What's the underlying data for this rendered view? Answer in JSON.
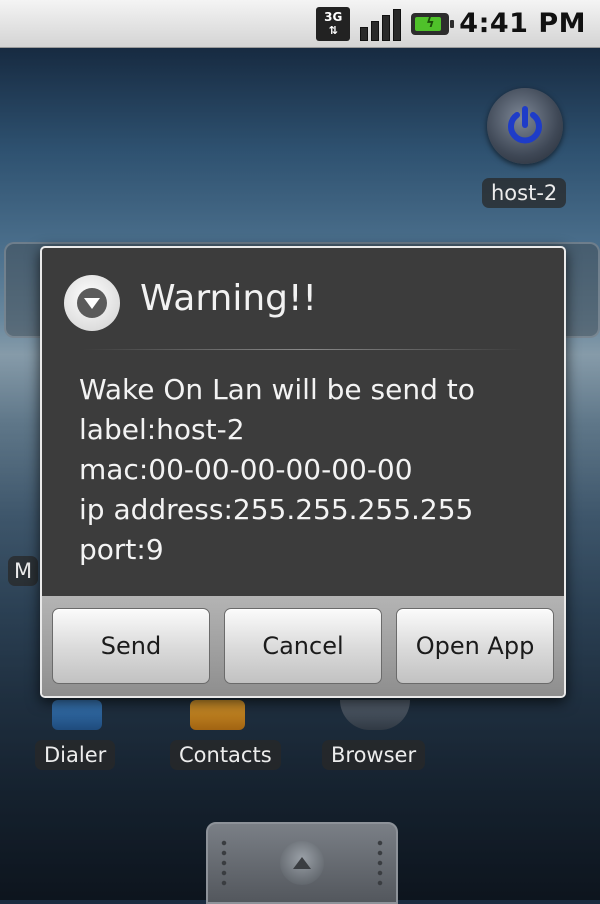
{
  "status_bar": {
    "network": "3G",
    "network_arrows": "⇅",
    "battery_symbol": "ϟ",
    "time": "4:41 PM"
  },
  "home": {
    "shortcut_label": "host-2",
    "partial_label": "M",
    "dock_apps": [
      {
        "label": "Dialer"
      },
      {
        "label": "Contacts"
      },
      {
        "label": "Browser"
      }
    ]
  },
  "dialog": {
    "title": "Warning!!",
    "message_lines": [
      "Wake On Lan will be send to",
      "label:host-2",
      "mac:00-00-00-00-00-00",
      "ip address:255.255.255.255",
      "port:9"
    ],
    "buttons": {
      "send": "Send",
      "cancel": "Cancel",
      "open_app": "Open App"
    }
  },
  "colors": {
    "power_icon_blue": "#1e3cc8",
    "battery_green": "#4fc12a",
    "dialog_background": "#3c3c3c"
  }
}
